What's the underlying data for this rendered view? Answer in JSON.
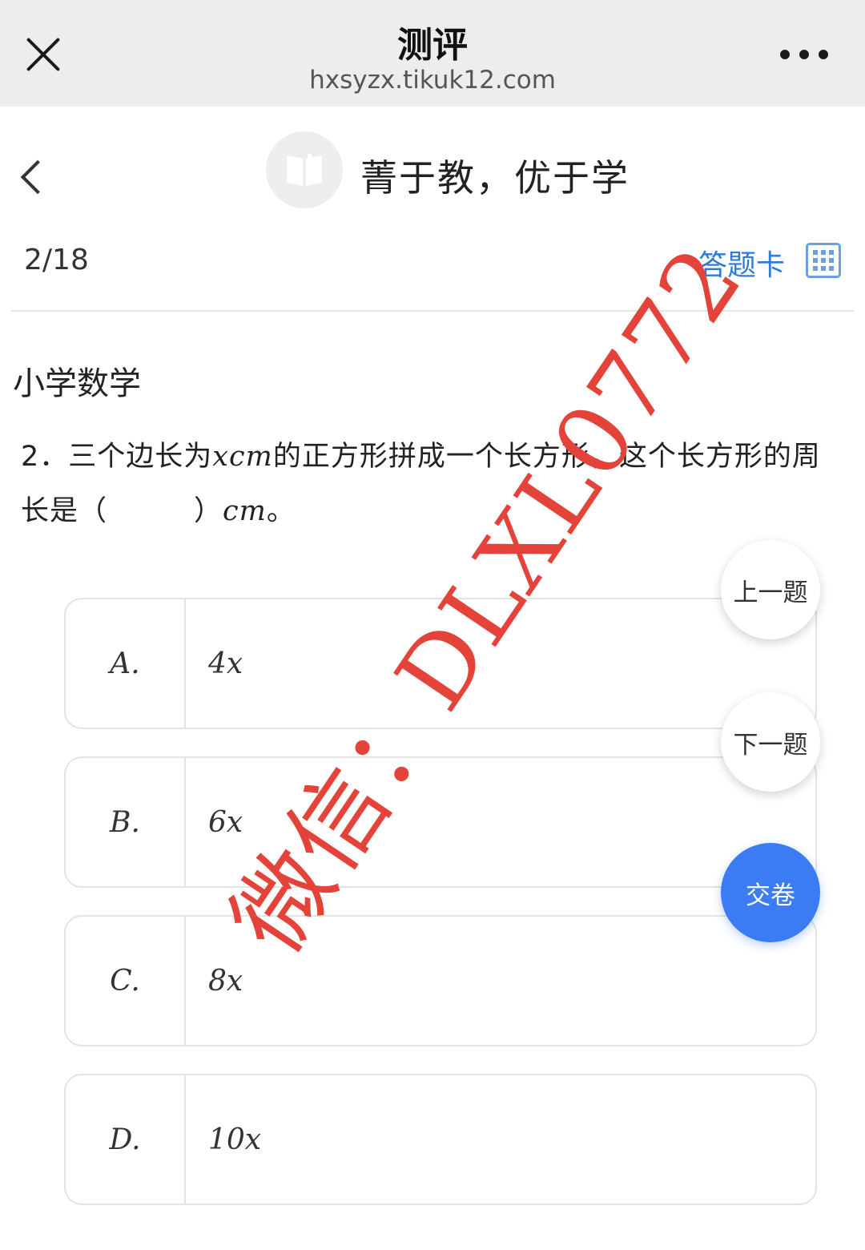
{
  "topbar": {
    "title": "测评",
    "url": "hxsyzx.tikuk12.com",
    "close_icon": "close-icon",
    "more_icon": "more-icon"
  },
  "header": {
    "back_icon": "chevron-left-icon",
    "logo_icon": "book-icon",
    "school_name": "菁于教，优于学"
  },
  "toolbar": {
    "progress": "2/18",
    "answer_card_label": "答题卡",
    "answer_card_icon": "grid-icon"
  },
  "question": {
    "subject": "小学数学",
    "number": "2．",
    "text_part1": "三个边长为",
    "var_x": "x",
    "unit": "cm",
    "text_part2": "的正方形拼成一个长方形，这个长方形的周长是（",
    "blank": "　　　",
    "text_part3": "）",
    "period": "。"
  },
  "options": [
    {
      "letter": "A.",
      "text": "4x"
    },
    {
      "letter": "B.",
      "text": "6x"
    },
    {
      "letter": "C.",
      "text": "8x"
    },
    {
      "letter": "D.",
      "text": "10x"
    }
  ],
  "float_buttons": {
    "prev": "上一题",
    "next": "下一题",
    "submit": "交卷"
  },
  "watermark": "微信：DLXL0772",
  "colors": {
    "accent_blue": "#3b7cf4",
    "link_blue": "#2f7ad6",
    "watermark_red": "#e4433a",
    "topbar_bg": "#ededed"
  }
}
